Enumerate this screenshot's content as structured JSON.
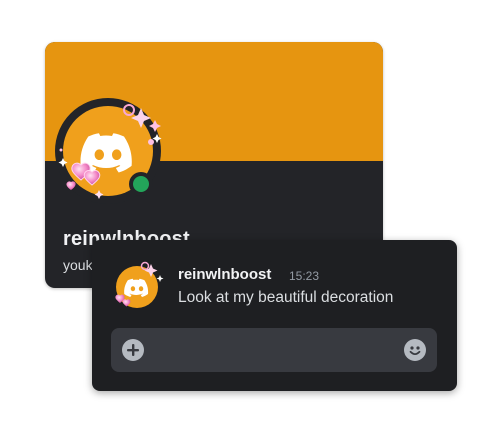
{
  "profile": {
    "username": "reinwlnboost",
    "subtext": "youk",
    "banner_color": "#e69510",
    "status": "online",
    "status_color": "#23a55a",
    "avatar_color": "#f0a01c",
    "avatar_icon": "discord-logo-icon",
    "decoration": "pink-hearts-sparkles-decoration"
  },
  "message": {
    "author": "reinwlnboost",
    "timestamp": "15:23",
    "text": "Look at my beautiful decoration"
  },
  "composer": {
    "placeholder": "",
    "add_icon": "plus-circle-icon",
    "emoji_icon": "smiley-icon"
  }
}
